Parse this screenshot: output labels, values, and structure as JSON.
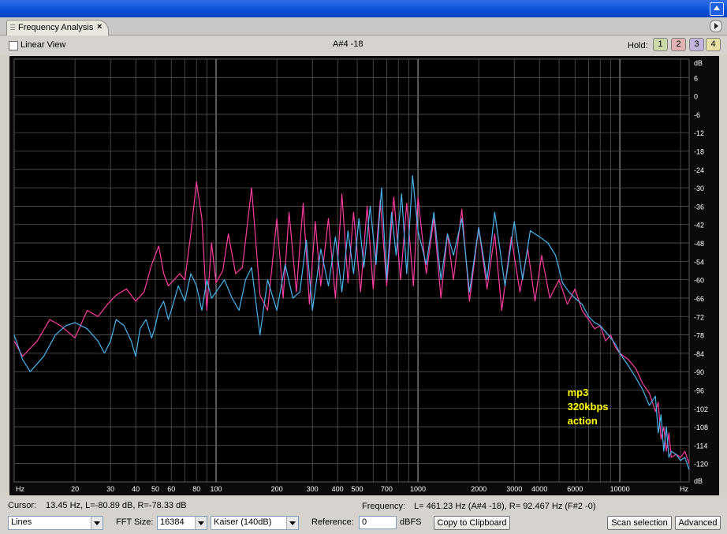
{
  "window": {
    "title": ""
  },
  "tab": {
    "label": "Frequency Analysis",
    "close": "×"
  },
  "toolbar": {
    "linear_view_label": "Linear View",
    "linear_view_checked": false,
    "note_readout": "A#4 -18",
    "hold_label": "Hold:",
    "hold_buttons": [
      {
        "label": "1",
        "color": "#c9d9a8"
      },
      {
        "label": "2",
        "color": "#e0b2b2"
      },
      {
        "label": "3",
        "color": "#c2b4dc"
      },
      {
        "label": "4",
        "color": "#e6e0a4"
      }
    ]
  },
  "status": {
    "cursor_label": "Cursor:",
    "cursor_value": "13.45 Hz, L=-80.89 dB, R=-78.33 dB",
    "frequency_label": "Frequency:",
    "frequency_value": "L= 461.23 Hz (A#4 -18), R= 92.467 Hz (F#2 -0)"
  },
  "controls": {
    "display_mode": "Lines",
    "fft_size_label": "FFT Size:",
    "fft_size": "16384",
    "window_function": "Kaiser (140dB)",
    "reference_label": "Reference:",
    "reference_value": "0",
    "reference_unit": "dBFS",
    "copy_button": "Copy to Clipboard",
    "scan_button": "Scan selection",
    "advanced_button": "Advanced"
  },
  "chart_data": {
    "type": "line",
    "x_scale": "log",
    "xlim": [
      10,
      22050
    ],
    "ylim": [
      -126,
      12
    ],
    "grid": true,
    "xlabel": "Hz",
    "ylabel": "dB",
    "x_tick_labels": [
      {
        "value": 20,
        "label": "20"
      },
      {
        "value": 30,
        "label": "30"
      },
      {
        "value": 40,
        "label": "40"
      },
      {
        "value": 50,
        "label": "50"
      },
      {
        "value": 60,
        "label": "60"
      },
      {
        "value": 80,
        "label": "80"
      },
      {
        "value": 100,
        "label": "100"
      },
      {
        "value": 200,
        "label": "200"
      },
      {
        "value": 300,
        "label": "300"
      },
      {
        "value": 400,
        "label": "400"
      },
      {
        "value": 500,
        "label": "500"
      },
      {
        "value": 700,
        "label": "700"
      },
      {
        "value": 1000,
        "label": "1000"
      },
      {
        "value": 2000,
        "label": "2000"
      },
      {
        "value": 3000,
        "label": "3000"
      },
      {
        "value": 4000,
        "label": "4000"
      },
      {
        "value": 6000,
        "label": "6000"
      },
      {
        "value": 10000,
        "label": "10000"
      }
    ],
    "y_ticks": [
      6,
      0,
      -6,
      -12,
      -18,
      -24,
      -30,
      -36,
      -42,
      -48,
      -54,
      -60,
      -66,
      -72,
      -78,
      -84,
      -90,
      -96,
      -102,
      -108,
      -114,
      -120
    ],
    "annotation": [
      "mp3",
      "320kbps",
      "action"
    ],
    "series": [
      {
        "color": "#ff3ca0",
        "x": [
          10,
          11,
          13,
          15,
          17,
          20,
          23,
          26,
          29,
          32,
          36,
          40,
          44,
          48,
          52,
          55,
          58,
          62,
          66,
          70,
          75,
          80,
          85,
          90,
          95,
          100,
          108,
          115,
          125,
          135,
          150,
          165,
          180,
          200,
          215,
          230,
          250,
          270,
          290,
          310,
          330,
          360,
          390,
          420,
          450,
          480,
          520,
          560,
          600,
          650,
          700,
          760,
          820,
          880,
          950,
          1000,
          1100,
          1200,
          1300,
          1400,
          1500,
          1650,
          1800,
          2000,
          2200,
          2400,
          2600,
          2900,
          3200,
          3500,
          3800,
          4100,
          4500,
          5000,
          5500,
          6000,
          6500,
          7000,
          7500,
          8000,
          8500,
          9000,
          9500,
          10000,
          11000,
          12000,
          13000,
          14000,
          15000,
          15500,
          16000,
          16500,
          17000,
          17500,
          18000,
          19000,
          20000,
          21000,
          22050
        ],
        "y": [
          -80,
          -85,
          -80,
          -73,
          -75,
          -79,
          -70,
          -72,
          -68,
          -65,
          -63,
          -67,
          -64,
          -55,
          -49,
          -58,
          -62,
          -60,
          -58,
          -60,
          -45,
          -28,
          -40,
          -70,
          -48,
          -61,
          -57,
          -45,
          -58,
          -56,
          -30,
          -65,
          -70,
          -40,
          -66,
          -38,
          -64,
          -35,
          -68,
          -41,
          -62,
          -40,
          -66,
          -32,
          -61,
          -38,
          -64,
          -36,
          -63,
          -34,
          -62,
          -33,
          -60,
          -35,
          -62,
          -33,
          -58,
          -40,
          -66,
          -45,
          -60,
          -37,
          -67,
          -43,
          -63,
          -45,
          -70,
          -46,
          -64,
          -50,
          -67,
          -52,
          -66,
          -60,
          -68,
          -63,
          -70,
          -73,
          -76,
          -75,
          -80,
          -78,
          -82,
          -84,
          -86,
          -89,
          -94,
          -97,
          -103,
          -100,
          -112,
          -108,
          -116,
          -110,
          -118,
          -117,
          -118,
          -116,
          -120
        ]
      },
      {
        "color": "#4ab4f0",
        "x": [
          10,
          11,
          12,
          14,
          16,
          18,
          20,
          23,
          26,
          28,
          30,
          32,
          35,
          38,
          40,
          42,
          45,
          48,
          50,
          52,
          55,
          58,
          60,
          65,
          70,
          75,
          80,
          85,
          90,
          95,
          100,
          110,
          120,
          130,
          140,
          150,
          165,
          180,
          200,
          220,
          240,
          260,
          280,
          300,
          330,
          360,
          390,
          420,
          450,
          480,
          510,
          540,
          580,
          620,
          660,
          700,
          740,
          780,
          830,
          880,
          940,
          1000,
          1100,
          1200,
          1300,
          1400,
          1500,
          1650,
          1800,
          2000,
          2200,
          2400,
          2700,
          3000,
          3300,
          3600,
          4000,
          4400,
          4800,
          5200,
          5600,
          6000,
          6500,
          7000,
          7500,
          8000,
          8500,
          9000,
          9500,
          10000,
          11000,
          12000,
          13000,
          14000,
          15000,
          15500,
          16000,
          16500,
          17000,
          17500,
          18000,
          19000,
          20000,
          21000,
          22050
        ],
        "y": [
          -78,
          -86,
          -90,
          -85,
          -78,
          -75,
          -74,
          -76,
          -80,
          -84,
          -80,
          -73,
          -75,
          -80,
          -85,
          -76,
          -73,
          -79,
          -75,
          -70,
          -67,
          -73,
          -70,
          -62,
          -67,
          -58,
          -62,
          -70,
          -60,
          -66,
          -64,
          -60,
          -66,
          -70,
          -60,
          -56,
          -78,
          -60,
          -70,
          -55,
          -66,
          -64,
          -47,
          -70,
          -50,
          -62,
          -46,
          -64,
          -44,
          -58,
          -40,
          -56,
          -36,
          -55,
          -30,
          -60,
          -38,
          -52,
          -32,
          -58,
          -26,
          -44,
          -55,
          -38,
          -60,
          -45,
          -52,
          -40,
          -64,
          -43,
          -60,
          -38,
          -62,
          -41,
          -60,
          -44,
          -46,
          -48,
          -52,
          -61,
          -64,
          -66,
          -68,
          -72,
          -74,
          -75,
          -77,
          -79,
          -81,
          -84,
          -88,
          -92,
          -96,
          -101,
          -98,
          -110,
          -104,
          -116,
          -108,
          -118,
          -116,
          -117,
          -119,
          -118,
          -122
        ]
      }
    ]
  }
}
